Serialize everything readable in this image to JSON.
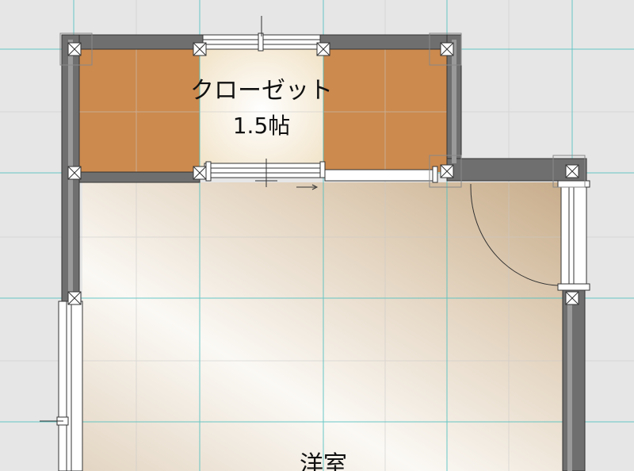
{
  "rooms": {
    "closet": {
      "name": "クローゼット",
      "area": "1.5帖"
    },
    "western": {
      "name": "洋室"
    }
  },
  "colors": {
    "background": "#e6e6e6",
    "wall": "#6f6f6f",
    "closet_fill": "#cc8a4e",
    "floor_light": "#fbf9f5",
    "floor_dark": "#c8ad8b",
    "grid_major": "#4fc0c0",
    "grid_minor": "#c9c9c9"
  }
}
